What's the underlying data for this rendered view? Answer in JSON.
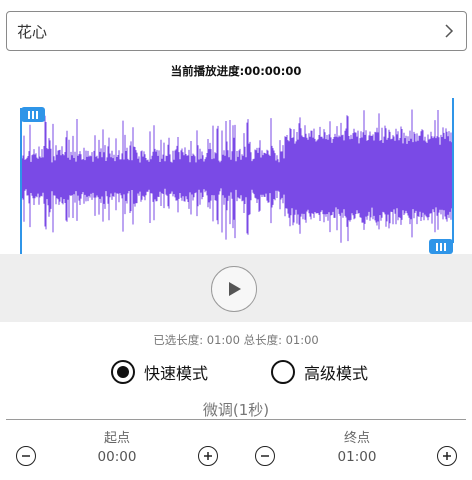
{
  "song": {
    "name": "花心",
    "chevron_icon": "chevron-right-icon"
  },
  "progress": {
    "text": "当前播放进度:00:00:00"
  },
  "waveform": {
    "color": "#7a4ae6",
    "selection_start_fraction": 0.0,
    "selection_end_fraction": 1.0,
    "handle_color": "#2f95e8"
  },
  "player": {
    "play_icon": "play-icon"
  },
  "length": {
    "text": "已选长度: 01:00 总长度: 01:00"
  },
  "modes": {
    "fast_label": "快速模式",
    "advanced_label": "高级模式",
    "selected": "fast"
  },
  "fine_tune": {
    "title": "微调(1秒)",
    "start_label": "起点",
    "end_label": "终点",
    "start_value": "00:00",
    "end_value": "01:00"
  }
}
